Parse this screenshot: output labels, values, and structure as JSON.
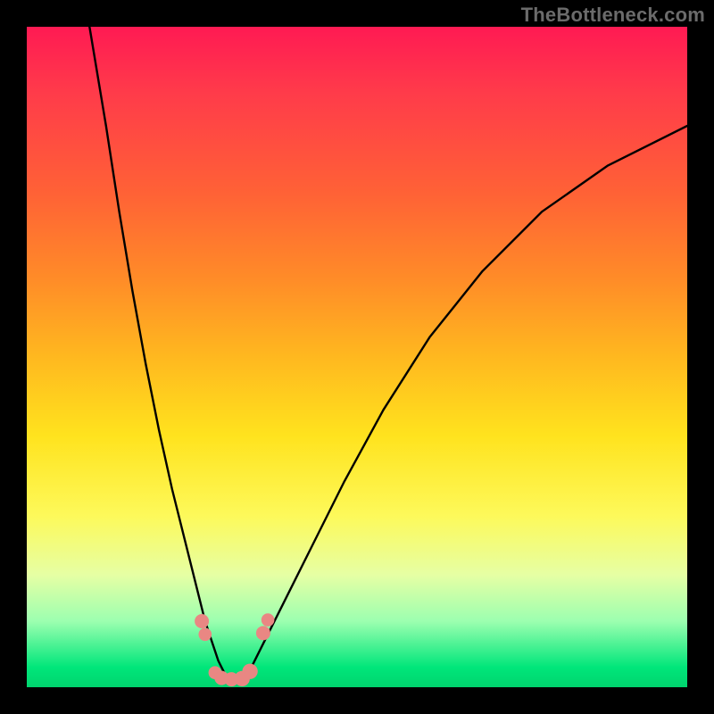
{
  "watermark": "TheBottleneck.com",
  "chart_data": {
    "type": "line",
    "title": "",
    "xlabel": "",
    "ylabel": "",
    "xlim": [
      0,
      100
    ],
    "ylim": [
      0,
      100
    ],
    "series": [
      {
        "name": "left-branch",
        "x": [
          9.5,
          12,
          14,
          16,
          18,
          20,
          22,
          24,
          25,
          26,
          27,
          28,
          29,
          30,
          31
        ],
        "y": [
          100,
          85,
          72,
          60,
          49,
          39,
          30,
          22,
          18,
          14,
          10,
          7,
          4,
          2,
          1
        ]
      },
      {
        "name": "right-branch",
        "x": [
          33,
          34,
          36,
          39,
          43,
          48,
          54,
          61,
          69,
          78,
          88,
          100
        ],
        "y": [
          1,
          3,
          7,
          13,
          21,
          31,
          42,
          53,
          63,
          72,
          79,
          85
        ]
      },
      {
        "name": "valley-flat",
        "x": [
          29,
          30,
          31,
          32,
          33
        ],
        "y": [
          1,
          0.8,
          0.8,
          0.8,
          1
        ]
      }
    ],
    "markers": [
      {
        "x": 26.5,
        "y": 10,
        "r": 1.2
      },
      {
        "x": 27.0,
        "y": 8,
        "r": 1.1
      },
      {
        "x": 28.5,
        "y": 2.2,
        "r": 1.1
      },
      {
        "x": 29.5,
        "y": 1.4,
        "r": 1.2
      },
      {
        "x": 31.0,
        "y": 1.2,
        "r": 1.2
      },
      {
        "x": 32.6,
        "y": 1.3,
        "r": 1.3
      },
      {
        "x": 33.8,
        "y": 2.4,
        "r": 1.3
      },
      {
        "x": 35.8,
        "y": 8.2,
        "r": 1.2
      },
      {
        "x": 36.5,
        "y": 10.2,
        "r": 1.1
      }
    ]
  }
}
